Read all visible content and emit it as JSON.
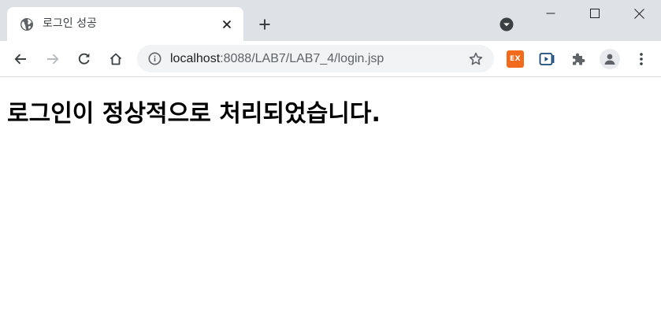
{
  "tab": {
    "title": "로그인 성공",
    "favicon": "globe-icon",
    "close_icon": "close-icon"
  },
  "tabstrip": {
    "new_tab_icon": "plus-icon",
    "tab_search_icon": "chevron-down-circle-icon"
  },
  "window_controls": [
    "minimize-icon",
    "maximize-icon",
    "close-icon"
  ],
  "toolbar": {
    "back_icon": "arrow-left-icon",
    "forward_icon": "arrow-right-icon",
    "reload_icon": "reload-icon",
    "home_icon": "home-icon"
  },
  "omnibox": {
    "info_icon": "info-icon",
    "url_host": "localhost",
    "url_rest": ":8088/LAB7/LAB7_4/login.jsp",
    "bookmark_icon": "star-icon"
  },
  "extensions": {
    "ex_label": "EX",
    "ex_color": "#f26b1d",
    "items": [
      "ex-extension-icon",
      "media-extension-icon",
      "puzzle-icon",
      "profile-icon",
      "more-vert-icon"
    ]
  },
  "page": {
    "heading": "로그인이 정상적으로 처리되었습니다."
  },
  "colors": {
    "tabstrip_bg": "#dee1e6",
    "omnibox_bg": "#f1f3f4",
    "icon": "#5f6368"
  }
}
